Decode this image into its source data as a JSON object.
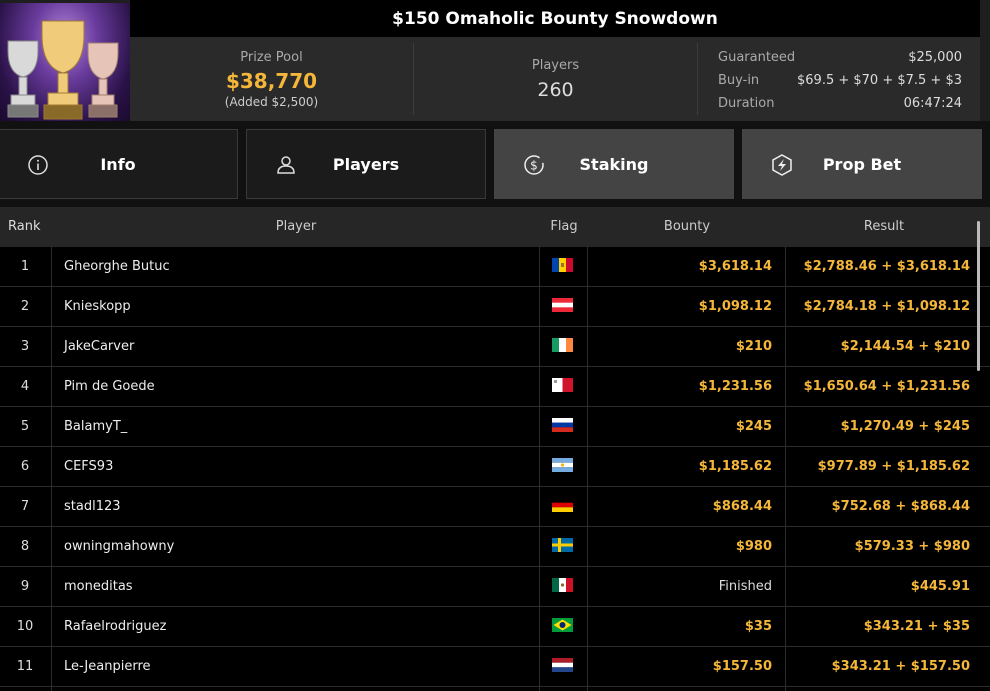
{
  "header": {
    "title": "$150 Omaholic Bounty Snowdown",
    "prize_pool_label": "Prize Pool",
    "prize_pool_value": "$38,770",
    "prize_pool_added": "(Added $2,500)",
    "players_label": "Players",
    "players_value": "260",
    "details": [
      {
        "label": "Guaranteed",
        "value": "$25,000"
      },
      {
        "label": "Buy-in",
        "value": "$69.5 + $70 + $7.5 + $3"
      },
      {
        "label": "Duration",
        "value": "06:47:24"
      }
    ]
  },
  "tabs": [
    {
      "label": "Info",
      "icon": "info-icon",
      "active": false
    },
    {
      "label": "Players",
      "icon": "user-icon",
      "active": false
    },
    {
      "label": "Staking",
      "icon": "dollar-coin-icon",
      "active": true
    },
    {
      "label": "Prop Bet",
      "icon": "prop-bet-icon",
      "active": false
    }
  ],
  "table": {
    "columns": [
      "Rank",
      "Player",
      "Flag",
      "Bounty",
      "Result"
    ],
    "rows": [
      {
        "rank": "1",
        "player": "Gheorghe Butuc",
        "flag": "moldova",
        "bounty": "$3,618.14",
        "result": "$2,788.46 + $3,618.14"
      },
      {
        "rank": "2",
        "player": "Knieskopp",
        "flag": "austria",
        "bounty": "$1,098.12",
        "result": "$2,784.18 + $1,098.12"
      },
      {
        "rank": "3",
        "player": "JakeCarver",
        "flag": "ireland",
        "bounty": "$210",
        "result": "$2,144.54 + $210"
      },
      {
        "rank": "4",
        "player": "Pim de Goede",
        "flag": "malta",
        "bounty": "$1,231.56",
        "result": "$1,650.64 + $1,231.56"
      },
      {
        "rank": "5",
        "player": "BalamyT_",
        "flag": "russia",
        "bounty": "$245",
        "result": "$1,270.49 + $245"
      },
      {
        "rank": "6",
        "player": "CEFS93",
        "flag": "argentina",
        "bounty": "$1,185.62",
        "result": "$977.89 + $1,185.62"
      },
      {
        "rank": "7",
        "player": "stadl123",
        "flag": "germany",
        "bounty": "$868.44",
        "result": "$752.68 + $868.44"
      },
      {
        "rank": "8",
        "player": "owningmahowny",
        "flag": "sweden",
        "bounty": "$980",
        "result": "$579.33 + $980"
      },
      {
        "rank": "9",
        "player": "moneditas",
        "flag": "mexico",
        "bounty": "Finished",
        "result": "$445.91"
      },
      {
        "rank": "10",
        "player": "Rafaelrodriguez",
        "flag": "brazil",
        "bounty": "$35",
        "result": "$343.21 + $35"
      },
      {
        "rank": "11",
        "player": "Le-Jeanpierre",
        "flag": "netherlands",
        "bounty": "$157.50",
        "result": "$343.21 + $157.50"
      }
    ]
  },
  "colors": {
    "accent": "#f5b73a",
    "active_tab": "#444444"
  }
}
